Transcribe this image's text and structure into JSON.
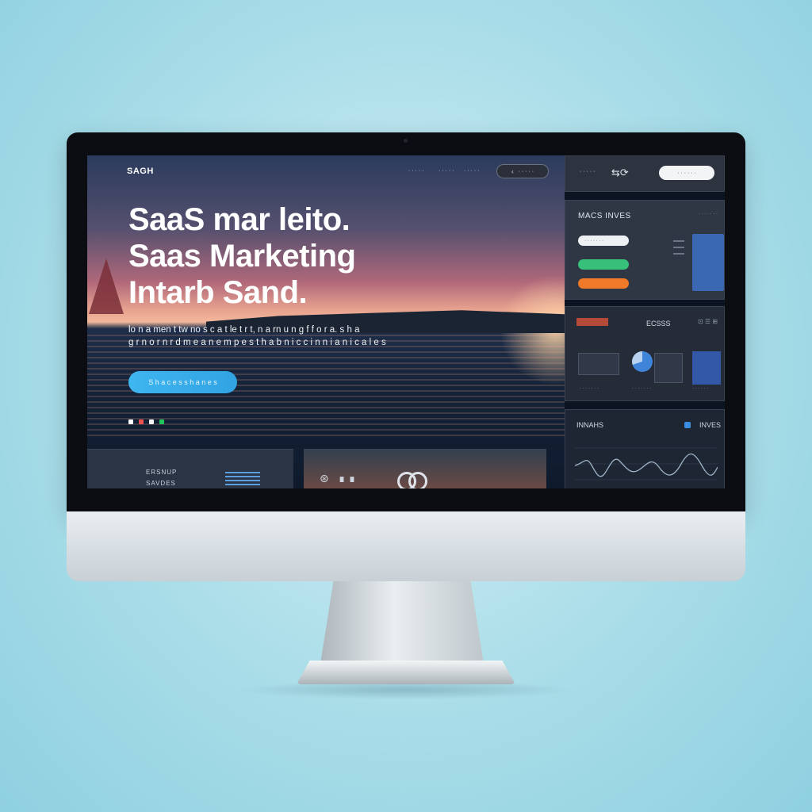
{
  "brand": {
    "logo": "SAGH"
  },
  "nav": {
    "links": [
      "· · · · ·",
      "· · · · ·",
      "· · · · ·"
    ],
    "sign_in": "· · · · ·"
  },
  "hero": {
    "headline_lines": [
      "SaaS mar leito.",
      "Saas Marketing",
      "Intarb Sand."
    ],
    "sub_lines": [
      "lo n a men t tw no s c a t le t r t, n a rn u n g f f o r a. s h a",
      "g r n o r n r d m e a n e m p e s t h a b n i c c i n n i a n i c a l e s"
    ],
    "cta": "S h a c e s  s h a n e s",
    "dots": [
      "#ffffff",
      "#f05252",
      "#f3f4f6",
      "#22c55e"
    ]
  },
  "bottom_cards": {
    "card1_label_1": "ERSNUP",
    "card1_label_2": "SAVDES",
    "card2_icons": "⊛ ∎∎"
  },
  "right_panels": {
    "top": {
      "label": "· · · · ·",
      "icon": "⇆⟳",
      "button": "· · · · · ·"
    },
    "panel1": {
      "title": "MACS INVES",
      "small": "· · · · · · ·",
      "pill1": "· · · · · · ·",
      "pill2": "",
      "pill3": ""
    },
    "panel2": {
      "title": "ECSSS",
      "icons": "⊡ ☰ ⊞",
      "foot1": "· · · · · · ·",
      "foot2": "· · · · · · ·",
      "foot3": "· · · · · ·"
    },
    "panel3": {
      "title": "INNAHS",
      "right": "INVES"
    }
  },
  "colors": {
    "cta": "#3fb6f0",
    "green": "#36c07a",
    "orange": "#f07a2a",
    "accent_blue": "#3358a8"
  }
}
